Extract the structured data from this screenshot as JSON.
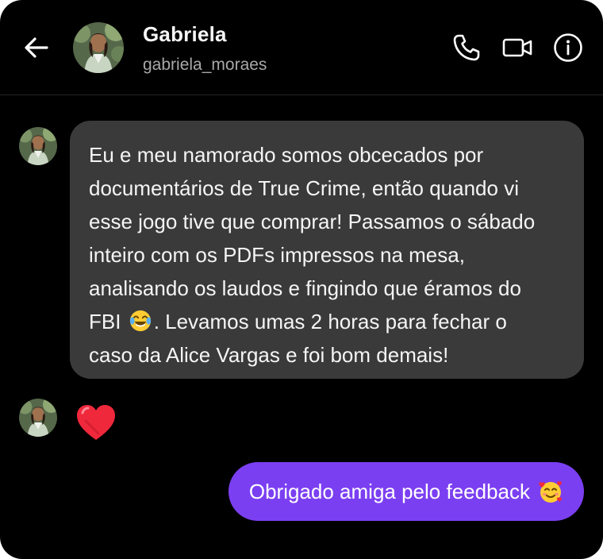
{
  "header": {
    "name": "Gabriela",
    "handle": "gabriela_moraes",
    "icons": [
      "back-arrow-icon",
      "phone-icon",
      "video-camera-icon",
      "info-icon"
    ]
  },
  "messages": [
    {
      "direction": "incoming",
      "lines": [
        "Eu e meu namorado somos obcecados por",
        "documentários de True Crime, então quando vi",
        "esse jogo tive que comprar! Passamos o sábado",
        "inteiro com os PDFs impressos na mesa,",
        "analisando os laudos e fingindo que éramos do"
      ],
      "line6_prefix": "FBI",
      "line6_suffix": ". Levamos umas 2 horas para fechar o",
      "line7": "caso da Alice Vargas e foi bom demais!",
      "inline_emoji": "tears-of-joy-emoji"
    },
    {
      "direction": "incoming",
      "reaction": "red-heart-emoji"
    },
    {
      "direction": "outgoing",
      "text": "Obrigado amiga pelo feedback",
      "trailing_emoji": "smiling-face-with-hearts-emoji"
    }
  ],
  "colors": {
    "background": "#000000",
    "incoming_bubble": "#3a3a3a",
    "outgoing_bubble": "#7b3ff2",
    "handle_text": "#a8a8a8"
  }
}
